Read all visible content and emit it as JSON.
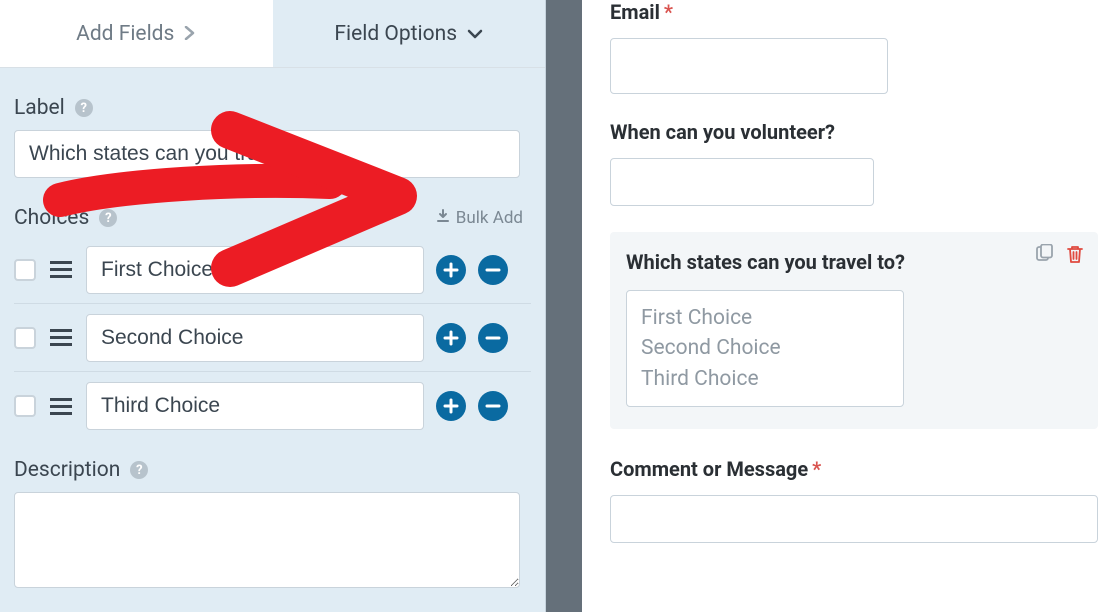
{
  "tabs": {
    "add_fields": "Add Fields",
    "field_options": "Field Options"
  },
  "sidebar": {
    "label_title": "Label",
    "label_value": "Which states can you travel to?",
    "choices_title": "Choices",
    "bulk_add": "Bulk Add",
    "choices": [
      {
        "value": "First Choice"
      },
      {
        "value": "Second Choice"
      },
      {
        "value": "Third Choice"
      }
    ],
    "description_title": "Description"
  },
  "preview": {
    "email_label": "Email",
    "volunteer_label": "When can you volunteer?",
    "states_label": "Which states can you travel to?",
    "states_options": [
      "First Choice",
      "Second Choice",
      "Third Choice"
    ],
    "comment_label": "Comment or Message"
  }
}
